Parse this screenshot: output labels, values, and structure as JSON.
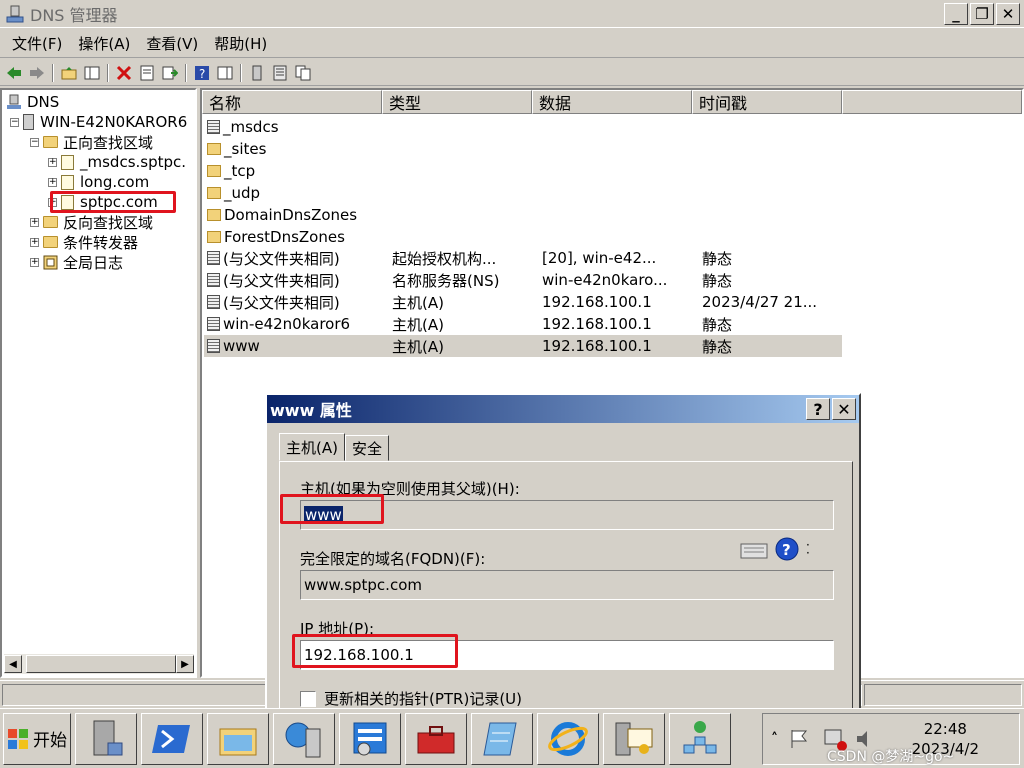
{
  "window": {
    "title": "DNS 管理器"
  },
  "menu": [
    "文件(F)",
    "操作(A)",
    "查看(V)",
    "帮助(H)"
  ],
  "tree": {
    "root": "DNS",
    "server": "WIN-E42N0KAROR6",
    "forward": "正向查找区域",
    "zones": [
      "_msdcs.sptpc.",
      "long.com",
      "sptpc.com"
    ],
    "reverse": "反向查找区域",
    "forwarders": "条件转发器",
    "global_logs": "全局日志"
  },
  "list": {
    "headers": [
      "名称",
      "类型",
      "数据",
      "时间戳"
    ],
    "rows": [
      {
        "name": "_msdcs",
        "type": "",
        "data": "",
        "time": "",
        "icon": "zone"
      },
      {
        "name": "_sites",
        "type": "",
        "data": "",
        "time": "",
        "icon": "folder"
      },
      {
        "name": "_tcp",
        "type": "",
        "data": "",
        "time": "",
        "icon": "folder"
      },
      {
        "name": "_udp",
        "type": "",
        "data": "",
        "time": "",
        "icon": "folder"
      },
      {
        "name": "DomainDnsZones",
        "type": "",
        "data": "",
        "time": "",
        "icon": "folder"
      },
      {
        "name": "ForestDnsZones",
        "type": "",
        "data": "",
        "time": "",
        "icon": "folder"
      },
      {
        "name": "(与父文件夹相同)",
        "type": "起始授权机构...",
        "data": "[20], win-e42...",
        "time": "静态",
        "icon": "record"
      },
      {
        "name": "(与父文件夹相同)",
        "type": "名称服务器(NS)",
        "data": "win-e42n0karo...",
        "time": "静态",
        "icon": "record"
      },
      {
        "name": "(与父文件夹相同)",
        "type": "主机(A)",
        "data": "192.168.100.1",
        "time": "2023/4/27 21...",
        "icon": "record"
      },
      {
        "name": "win-e42n0karor6",
        "type": "主机(A)",
        "data": "192.168.100.1",
        "time": "静态",
        "icon": "record"
      },
      {
        "name": "www",
        "type": "主机(A)",
        "data": "192.168.100.1",
        "time": "静态",
        "icon": "record",
        "selected": true
      }
    ]
  },
  "dialog": {
    "title": "www 属性",
    "tabs": [
      "主机(A)",
      "安全"
    ],
    "host_label": "主机(如果为空则使用其父域)(H):",
    "host_value": "www",
    "fqdn_label": "完全限定的域名(FQDN)(F):",
    "fqdn_value": "www.sptpc.com",
    "ip_label": "IP 地址(P):",
    "ip_value": "192.168.100.1",
    "ptr_label": "更新相关的指针(PTR)记录(U)"
  },
  "taskbar": {
    "start": "开始",
    "time": "22:48",
    "date": "2023/4/2",
    "watermark": "CSDN @梦湖~go~"
  }
}
